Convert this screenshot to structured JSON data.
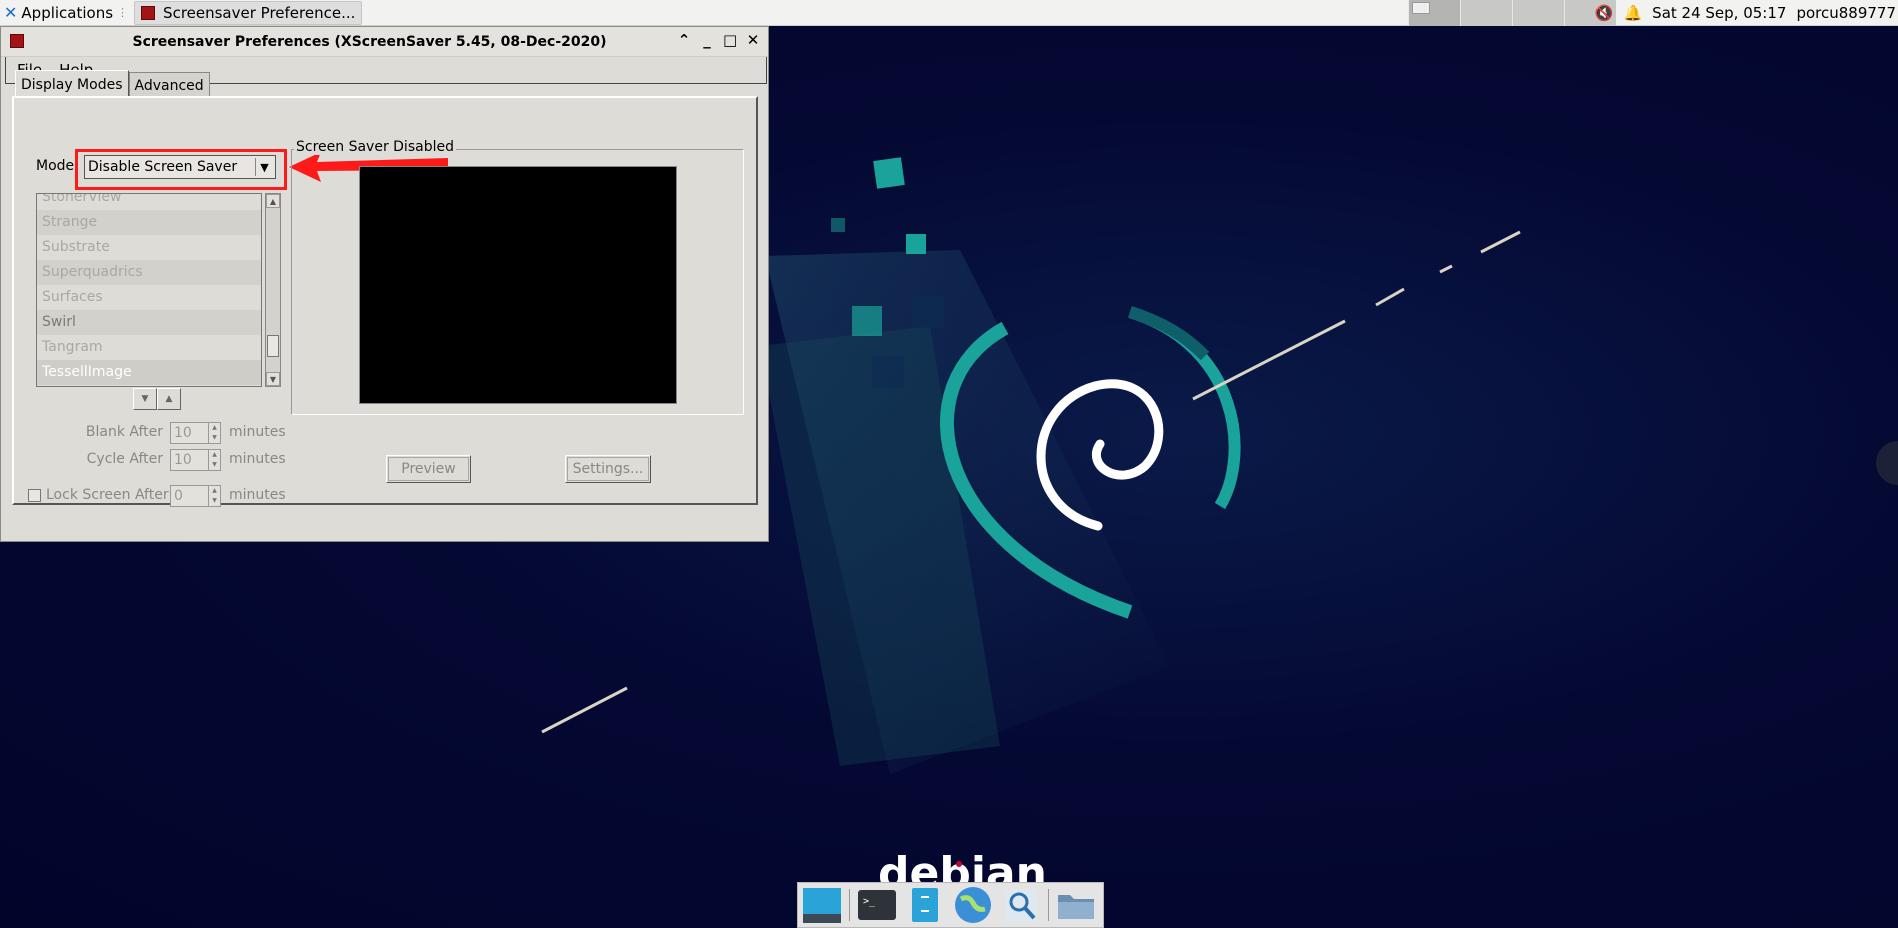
{
  "panel": {
    "applications_label": "Applications",
    "task_label": "Screensaver Preference...",
    "datetime": "Sat 24 Sep, 05:17",
    "user": "porcu889777"
  },
  "window": {
    "title": "Screensaver Preferences  (XScreenSaver 5.45, 08-Dec-2020)",
    "menu": {
      "file": "File",
      "help": "Help"
    },
    "tabs": [
      "Display Modes",
      "Advanced"
    ],
    "mode": {
      "label": "Mode",
      "selected": "Disable Screen Saver"
    },
    "hack_list": [
      "StonerView",
      "Strange",
      "Substrate",
      "Superquadrics",
      "Surfaces",
      "Swirl",
      "Tangram",
      "TessellImage"
    ],
    "preview_group_label": "Screen Saver Disabled",
    "preview_button": "Preview",
    "settings_button": "Settings...",
    "blank_after": {
      "label": "Blank After",
      "value": "10",
      "unit": "minutes"
    },
    "cycle_after": {
      "label": "Cycle After",
      "value": "10",
      "unit": "minutes"
    },
    "lock_after": {
      "label": "Lock Screen After",
      "value": "0",
      "unit": "minutes"
    }
  },
  "desktop": {
    "brand_text": "debian"
  },
  "colors": {
    "annotation_red": "#ff1a1a",
    "wallpaper_teal": "#1aa39a",
    "wallpaper_bg": "#020428"
  }
}
